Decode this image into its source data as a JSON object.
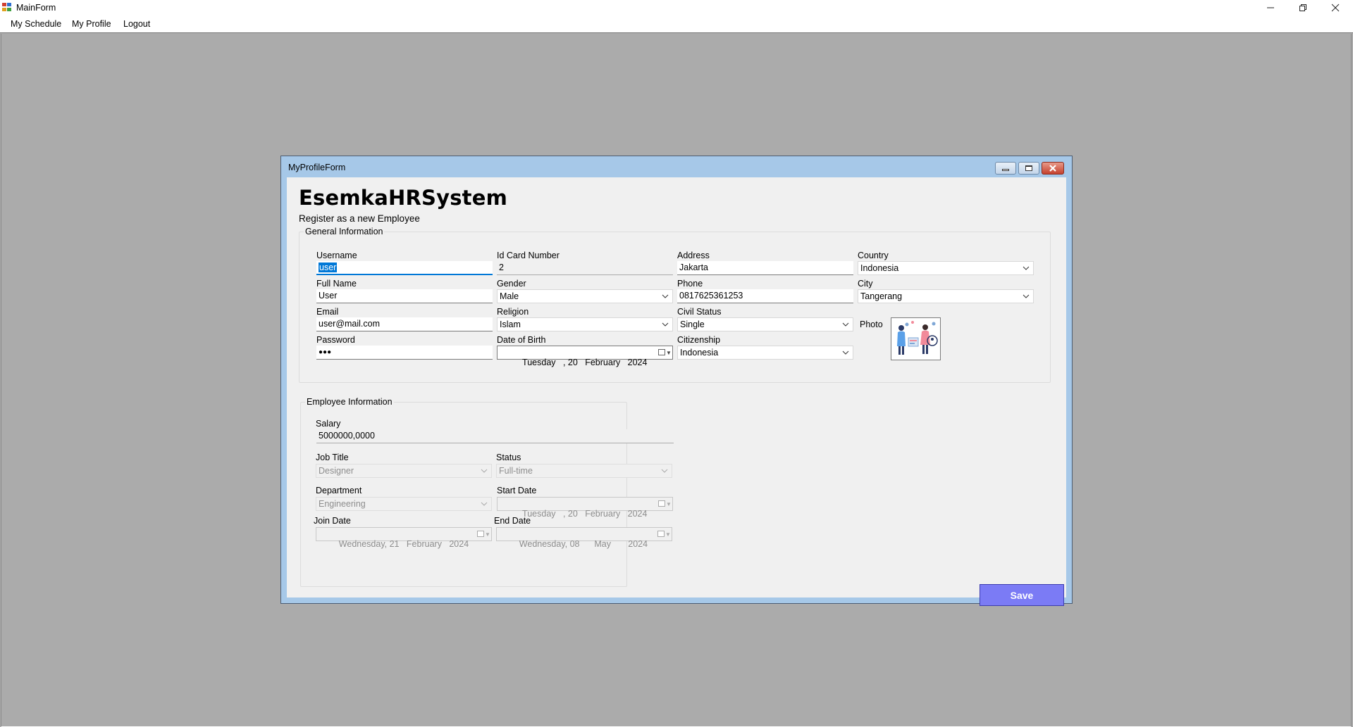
{
  "window": {
    "title": "MainForm"
  },
  "menu": {
    "schedule": "My Schedule",
    "profile": "My Profile",
    "logout": "Logout"
  },
  "child": {
    "title": "MyProfileForm"
  },
  "header": {
    "title": "EsemkaHRSystem",
    "subtitle": "Register as a new Employee"
  },
  "general": {
    "legend": "General Information",
    "username_label": "Username",
    "username_value": "user",
    "fullname_label": "Full Name",
    "fullname_value": "User",
    "email_label": "Email",
    "email_value": "user@mail.com",
    "password_label": "Password",
    "password_value": "●●●",
    "idcard_label": "Id Card Number",
    "idcard_value": "2",
    "gender_label": "Gender",
    "gender_value": "Male",
    "religion_label": "Religion",
    "religion_value": "Islam",
    "dob_label": "Date of Birth",
    "dob_value": " Tuesday   , 20   February   2024",
    "address_label": "Address",
    "address_value": "Jakarta",
    "phone_label": "Phone",
    "phone_value": "0817625361253",
    "civil_label": "Civil Status",
    "civil_value": "Single",
    "citizenship_label": "Citizenship",
    "citizenship_value": "Indonesia",
    "country_label": "Country",
    "country_value": "Indonesia",
    "city_label": "City",
    "city_value": "Tangerang",
    "photo_label": "Photo"
  },
  "employee": {
    "legend": "Employee Information",
    "salary_label": "Salary",
    "salary_value": "5000000,0000",
    "jobtitle_label": "Job Title",
    "jobtitle_value": "Designer",
    "status_label": "Status",
    "status_value": "Full-time",
    "department_label": "Department",
    "department_value": "Engineering",
    "startdate_label": "Start Date",
    "startdate_value": " Tuesday   , 20   February   2024",
    "joindate_label": "Join Date",
    "joindate_value": "Wednesday, 21   February   2024",
    "enddate_label": "End Date",
    "enddate_value": "Wednesday, 08      May       2024"
  },
  "actions": {
    "save": "Save"
  },
  "colors": {
    "save_button": "#7b7bf5",
    "selection": "#0078d7",
    "mdi_background": "#ababab"
  }
}
